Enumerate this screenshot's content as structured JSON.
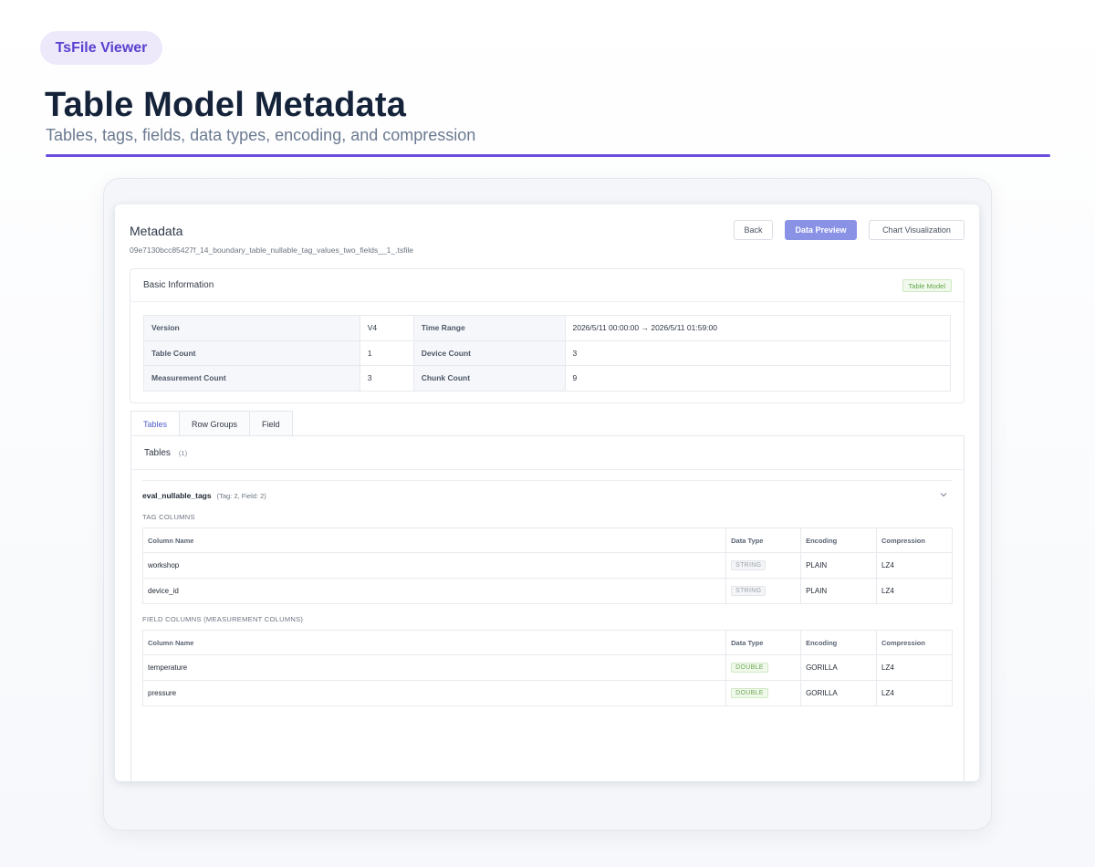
{
  "header": {
    "app_badge": "TsFile Viewer",
    "title": "Table Model Metadata",
    "subtitle": "Tables, tags, fields, data types, encoding, and compression"
  },
  "screen": {
    "title": "Metadata",
    "file_name": "09e7130bcc85427f_14_boundary_table_nullable_tag_values_two_fields__1_.tsfile",
    "buttons": {
      "back": "Back",
      "data_preview": "Data Preview",
      "chart_visualization": "Chart Visualization"
    },
    "basic_info": {
      "title": "Basic Information",
      "model_tag": "Table Model",
      "rows": [
        {
          "k1": "Version",
          "v1": "V4",
          "k2": "Time Range",
          "v2": "2026/5/11 00:00:00 → 2026/5/11 01:59:00"
        },
        {
          "k1": "Table Count",
          "v1": "1",
          "k2": "Device Count",
          "v2": "3"
        },
        {
          "k1": "Measurement Count",
          "v1": "3",
          "k2": "Chunk Count",
          "v2": "9"
        }
      ]
    },
    "tabs": [
      "Tables",
      "Row Groups",
      "Field"
    ],
    "active_tab": "Tables",
    "tables_panel": {
      "title": "Tables",
      "count": "(1)",
      "table": {
        "name": "eval_nullable_tags",
        "summary": "(Tag: 2, Field: 2)",
        "tag_section_label": "TAG COLUMNS",
        "field_section_label": "FIELD COLUMNS (MEASUREMENT COLUMNS)",
        "headers": [
          "Column Name",
          "Data Type",
          "Encoding",
          "Compression"
        ],
        "tag_columns": [
          {
            "name": "workshop",
            "type": "STRING",
            "encoding": "PLAIN",
            "compression": "LZ4"
          },
          {
            "name": "device_id",
            "type": "STRING",
            "encoding": "PLAIN",
            "compression": "LZ4"
          }
        ],
        "field_columns": [
          {
            "name": "temperature",
            "type": "DOUBLE",
            "encoding": "GORILLA",
            "compression": "LZ4"
          },
          {
            "name": "pressure",
            "type": "DOUBLE",
            "encoding": "GORILLA",
            "compression": "LZ4"
          }
        ]
      }
    }
  },
  "colors": {
    "accent": "#6a4ce0",
    "primary_button": "#8a92e6",
    "tag_green": "#62a84a"
  }
}
